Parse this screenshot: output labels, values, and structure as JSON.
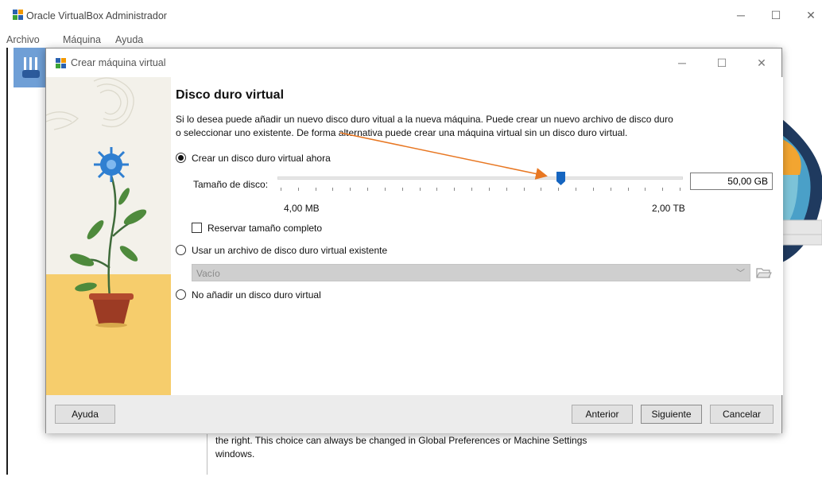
{
  "main_window": {
    "title": "Oracle VirtualBox Administrador",
    "menu": [
      "Archivo",
      "Máquina",
      "Ayuda"
    ],
    "behind_text_line1": "the right. This choice can always be changed in Global Preferences or Machine Settings",
    "behind_text_line2": "windows."
  },
  "dialog": {
    "title": "Crear máquina virtual",
    "heading": "Disco duro virtual",
    "description_line1": "Si lo desea puede añadir un nuevo disco duro vitual a la nueva máquina. Puede crear un nuevo archivo de disco duro",
    "description_line2": "o seleccionar uno existente. De forma alternativa puede crear una máquina virtual sin un disco duro virtual.",
    "options": {
      "create_now": "Crear un disco duro virtual ahora",
      "use_existing": "Usar un archivo de disco duro virtual existente",
      "no_disk": "No añadir un disco duro virtual"
    },
    "selected_option": "create_now",
    "disk_size": {
      "label": "Tamaño de disco:",
      "value": "50,00 GB",
      "min_label": "4,00 MB",
      "max_label": "2,00 TB",
      "slider_fraction": 0.703
    },
    "reserve_full_size": {
      "label": "Reservar tamaño completo",
      "checked": false
    },
    "existing_file_select": "Vacío",
    "buttons": {
      "help": "Ayuda",
      "back": "Anterior",
      "next": "Siguiente",
      "cancel": "Cancelar"
    }
  },
  "colors": {
    "slider_handle": "#1565c0",
    "arrow_annotation": "#e87722",
    "tool_icon": "#4a86c8"
  },
  "icons": {
    "app_logo": "virtualbox-logo-icon",
    "folder": "folder-open-icon",
    "dropdown": "chevron-down-icon"
  }
}
